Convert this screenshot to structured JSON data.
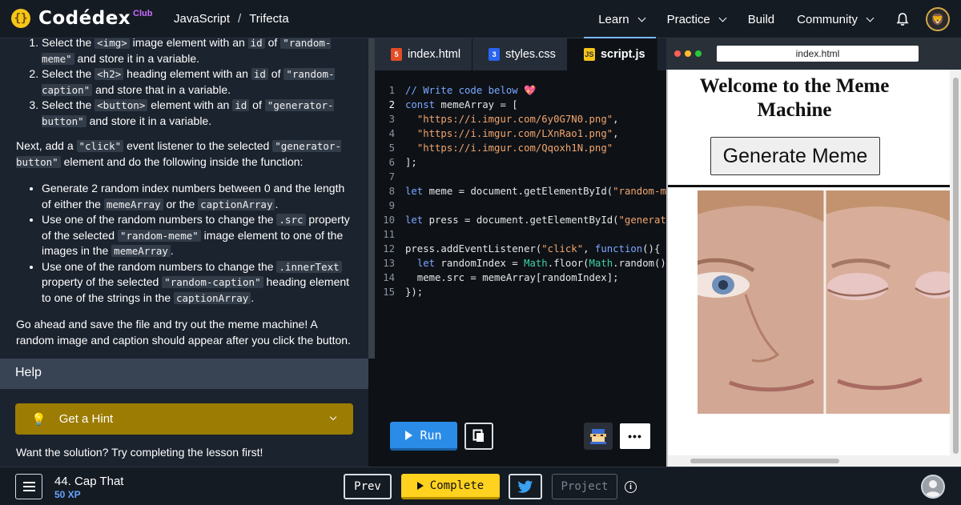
{
  "nav": {
    "logo_coin": "{}",
    "brand": "Codédex",
    "club": "Club",
    "breadcrumb": [
      "JavaScript",
      "/",
      "Trifecta"
    ],
    "links": [
      {
        "label": "Learn",
        "dropdown": true
      },
      {
        "label": "Practice",
        "dropdown": true
      },
      {
        "label": "Build",
        "dropdown": false
      },
      {
        "label": "Community",
        "dropdown": true
      }
    ]
  },
  "lesson": {
    "steps": [
      {
        "a": "Select the ",
        "c1": "<img>",
        "b": " image element with an ",
        "c2": "id",
        "d": " of ",
        "c3": "\"random-meme\"",
        "e": " and store it in a variable."
      },
      {
        "a": "Select the ",
        "c1": "<h2>",
        "b": " heading element with an ",
        "c2": "id",
        "d": " of ",
        "c3": "\"random-caption\"",
        "e": " and store that in a variable."
      },
      {
        "a": "Select the ",
        "c1": "<button>",
        "b": " element with an ",
        "c2": "id",
        "d": " of ",
        "c3": "\"generator-button\"",
        "e": " and store it in a variable."
      }
    ],
    "next": {
      "a": "Next, add a ",
      "c1": "\"click\"",
      "b": " event listener to the selected ",
      "c2": "\"generator-button\"",
      "e": " element and do the following inside the function:"
    },
    "bullets": [
      {
        "a": "Generate 2 random index numbers between 0 and the length of either the ",
        "c1": "memeArray",
        "b": " or the ",
        "c2": "captionArray",
        "e": "."
      },
      {
        "a": "Use one of the random numbers to change the ",
        "c1": ".src",
        "b": " property of the selected ",
        "c2": "\"random-meme\"",
        "d": " image element to one of the images in the ",
        "c3": "memeArray",
        "e": "."
      },
      {
        "a": "Use one of the random numbers to change the ",
        "c1": ".innerText",
        "b": " property of the selected ",
        "c2": "\"random-caption\"",
        "d": " heading element to one of the strings in the ",
        "c3": "captionArray",
        "e": "."
      }
    ],
    "closing": "Go ahead and save the file and try out the meme machine! A random image and caption should appear after you click the button."
  },
  "help": {
    "title": "Help",
    "hint_label": "Get a Hint",
    "solution_text": "Want the solution? Try completing the lesson first!"
  },
  "editor": {
    "tabs": [
      {
        "label": "index.html",
        "icon": "html5-icon",
        "color": "#e44d26"
      },
      {
        "label": "styles.css",
        "icon": "css3-icon",
        "color": "#2965f1"
      },
      {
        "label": "script.js",
        "icon": "js-icon",
        "color": "#f5c518"
      }
    ],
    "lines": [
      "// Write code below 💖",
      "const memeArray = [",
      "  \"https://i.imgur.com/6y0G7N0.png\",",
      "  \"https://i.imgur.com/LXnRao1.png\",",
      "  \"https://i.imgur.com/Qqoxh1N.png\"",
      "];",
      "",
      "let meme = document.getElementById(\"random-m",
      "",
      "let press = document.getElementById(\"generat",
      "",
      "press.addEventListener(\"click\", function(){",
      "  let randomIndex = Math.floor(Math.random()",
      "  meme.src = memeArray[randomIndex];",
      "});"
    ],
    "current_line": 2,
    "run_label": "Run"
  },
  "preview": {
    "url": "index.html",
    "title": "Welcome to the Meme Machine",
    "button": "Generate Meme"
  },
  "footer": {
    "lesson": "44. Cap That",
    "xp": "50 XP",
    "prev": "Prev",
    "complete": "Complete",
    "project": "Project",
    "info": "i"
  }
}
